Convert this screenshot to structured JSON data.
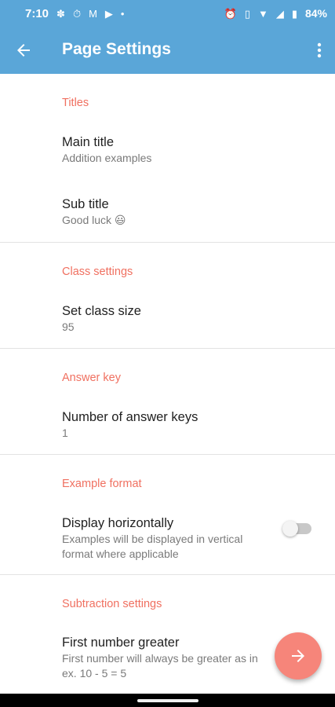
{
  "status_bar": {
    "time": "7:10",
    "battery": "84%",
    "left_icons": [
      "slack-icon",
      "timer-icon",
      "gmail-icon",
      "play-store-icon",
      "dot-icon"
    ],
    "right_icons": [
      "alarm-icon",
      "vibrate-icon",
      "wifi-icon",
      "signal-icon",
      "battery-icon"
    ]
  },
  "app_bar": {
    "title": "Page Settings"
  },
  "sections": [
    {
      "header": "Titles",
      "items": [
        {
          "title": "Main title",
          "subtitle": "Addition examples"
        },
        {
          "title": "Sub title",
          "subtitle": "Good luck 😃"
        }
      ]
    },
    {
      "header": "Class settings",
      "items": [
        {
          "title": "Set class size",
          "subtitle": "95"
        }
      ]
    },
    {
      "header": "Answer key",
      "items": [
        {
          "title": "Number of answer keys",
          "subtitle": "1"
        }
      ]
    },
    {
      "header": "Example format",
      "items": [
        {
          "title": "Display horizontally",
          "subtitle": "Examples will be displayed in vertical format where applicable",
          "toggle": false
        }
      ]
    },
    {
      "header": "Subtraction settings",
      "items": [
        {
          "title": "First number greater",
          "subtitle": "First number will always be greater as in ex. 10 - 5 = 5"
        }
      ]
    }
  ],
  "colors": {
    "primary": "#5aa6d8",
    "accent": "#f07060",
    "fab": "#f6857a"
  }
}
